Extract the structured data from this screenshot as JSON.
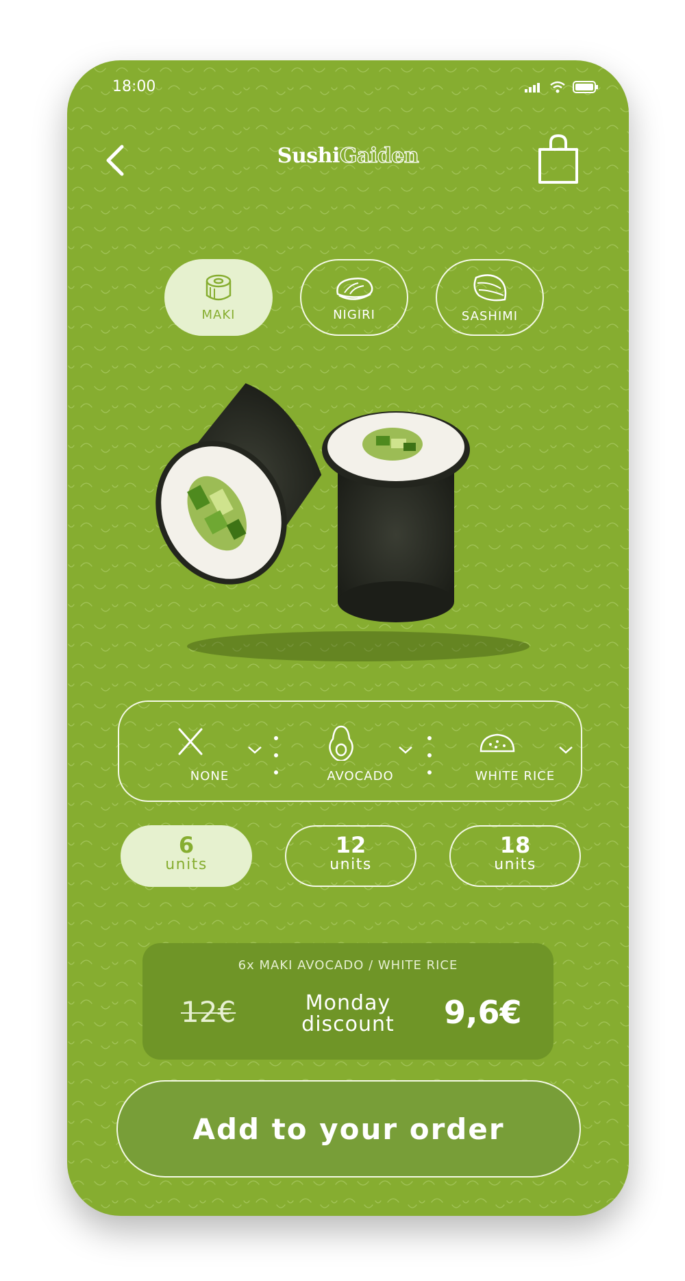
{
  "status_bar": {
    "time": "18:00"
  },
  "header": {
    "logo_part1": "Sushi",
    "logo_part2": "Gaiden"
  },
  "categories": [
    {
      "label": "MAKI",
      "icon": "maki-roll-icon",
      "selected": true
    },
    {
      "label": "NIGIRI",
      "icon": "nigiri-icon",
      "selected": false
    },
    {
      "label": "SASHIMI",
      "icon": "sashimi-icon",
      "selected": false
    }
  ],
  "options": [
    {
      "label": "NONE",
      "icon": "x-icon"
    },
    {
      "label": "AVOCADO",
      "icon": "avocado-icon"
    },
    {
      "label": "WHITE RICE",
      "icon": "rice-icon"
    }
  ],
  "units": [
    {
      "count": "6",
      "label": "units",
      "selected": true
    },
    {
      "count": "12",
      "label": "units",
      "selected": false
    },
    {
      "count": "18",
      "label": "units",
      "selected": false
    }
  ],
  "summary": {
    "title": "6x MAKI AVOCADO / WHITE RICE",
    "old_price": "12€",
    "discount_line1": "Monday",
    "discount_line2": "discount",
    "price": "9,6€"
  },
  "cta": {
    "label": "Add to your order"
  },
  "colors": {
    "background": "#86ad30",
    "accent_light": "#e6f1cf",
    "summary_bg": "#6f9527",
    "button_bg": "#789e38"
  }
}
